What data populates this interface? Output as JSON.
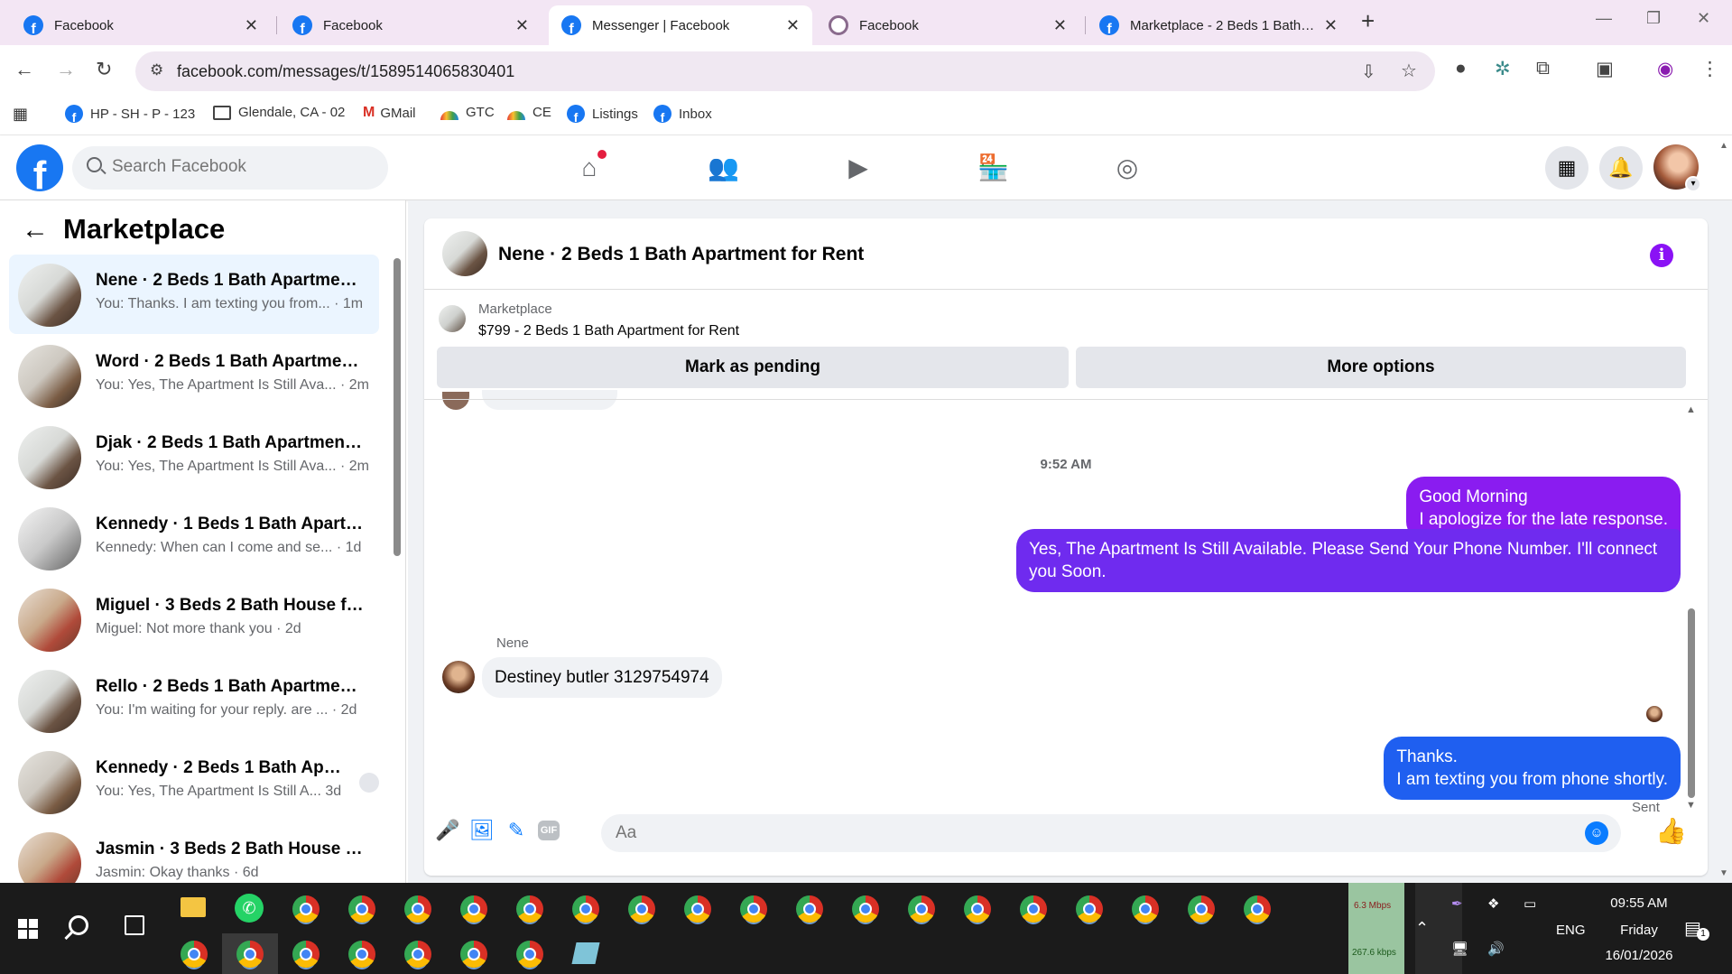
{
  "browser": {
    "tabs": [
      {
        "title": "Facebook",
        "active": false
      },
      {
        "title": "Facebook",
        "active": false
      },
      {
        "title": "Messenger | Facebook",
        "active": true
      },
      {
        "title": "Facebook",
        "active": false
      },
      {
        "title": "Marketplace - 2 Beds 1 Bath Ap",
        "active": false
      }
    ],
    "url": "facebook.com/messages/t/1589514065830401",
    "bookmarks": [
      "HP - SH - P - 123",
      "Glendale, CA - 02",
      "GMail",
      "GTC",
      "CE",
      "Listings",
      "Inbox"
    ]
  },
  "fb_header": {
    "search_placeholder": "Search Facebook"
  },
  "sidebar": {
    "title": "Marketplace",
    "conversations": [
      {
        "name": "Nene · 2 Beds 1 Bath Apartment ...",
        "preview": "You: Thanks. I am texting you from... · 1m",
        "active": true
      },
      {
        "name": "Word · 2 Beds 1 Bath Apartment...",
        "preview": "You: Yes, The Apartment Is Still Ava... · 2m"
      },
      {
        "name": "Djak · 2 Beds 1 Bath Apartment f...",
        "preview": "You: Yes, The Apartment Is Still Ava... · 2m"
      },
      {
        "name": "Kennedy · 1 Beds 1 Bath Apartm...",
        "preview": "Kennedy: When can I come and se... · 1d"
      },
      {
        "name": "Miguel · 3 Beds 2 Bath House fo...",
        "preview": "Miguel: Not more thank you · 2d"
      },
      {
        "name": "Rello · 2 Beds 1 Bath Apartment ...",
        "preview": "You: I'm waiting for your reply. are ... · 2d"
      },
      {
        "name": "Kennedy · 2 Beds 1 Bath Apart...",
        "preview": "You: Yes, The Apartment Is Still A... 3d"
      },
      {
        "name": "Jasmin · 3 Beds 2 Bath House fo...",
        "preview": "Jasmin: Okay thanks · 6d"
      }
    ]
  },
  "chat": {
    "title": "Nene · 2 Beds 1 Bath Apartment for Rent",
    "listing_source": "Marketplace",
    "listing_title": "$799 - 2 Beds 1 Bath Apartment for Rent",
    "mark_pending_label": "Mark as pending",
    "more_options_label": "More options",
    "timestamp": "9:52 AM",
    "messages": {
      "out1": [
        "Good Morning",
        "I apologize for the late response."
      ],
      "out2": [
        "Yes, The Apartment Is Still Available. Please Send Your Phone Number. I'll connect",
        "you Soon."
      ],
      "sender_name": "Nene",
      "in1": "Destiney butler 3129754974",
      "out3": [
        "Thanks.",
        "I am texting you from phone shortly."
      ]
    },
    "sent_status": "Sent",
    "composer_placeholder": "Aa",
    "gif_label": "GIF"
  },
  "taskbar": {
    "net_up": "6.3 Mbps",
    "net_down": "267.6 kbps",
    "language": "ENG",
    "time": "09:55 AM",
    "day": "Friday",
    "date": "16/01/2026",
    "notification_count": "1"
  },
  "colors": {
    "fb_blue": "#1877f2",
    "bubble_purple": "#8a1cf0",
    "bubble_violet": "#6f2bef",
    "bubble_blue": "#1f5ff0"
  }
}
